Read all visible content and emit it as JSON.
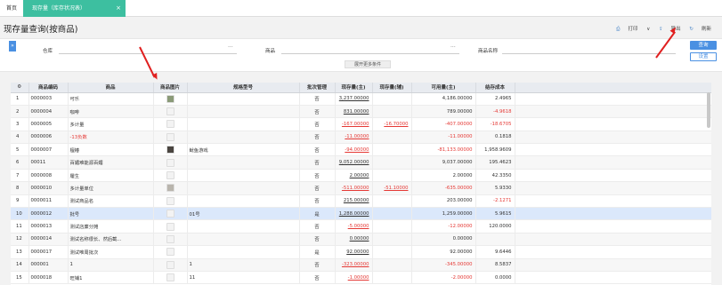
{
  "tabs": {
    "home": "首页",
    "active": "现存量（库存状况表）",
    "close": "×"
  },
  "page": {
    "title": "现存量查询(按商品)"
  },
  "toolbar": {
    "print": "打印",
    "print_caret": "∨",
    "export": "导出",
    "refresh": "刷新"
  },
  "search": {
    "collapse": "»",
    "warehouse_label": "仓库",
    "product_label": "商品",
    "product_name_label": "商品名称",
    "dots": "···",
    "query_button": "查询",
    "settings_button": "设置",
    "expand_more": "展开更多条件"
  },
  "table": {
    "columns": [
      "",
      "商品编码",
      "商品",
      "商品图片",
      "规格型号",
      "批次管理",
      "现存量(主)",
      "现存量(辅)",
      "可用量(主)",
      "结存成本"
    ],
    "rows": [
      {
        "idx": "1",
        "code": "0000003",
        "name": "可乐",
        "thumb": "photo",
        "spec": "",
        "batch": "否",
        "qty_main": "3,237.00000",
        "qty_aux": "",
        "avail": "4,186.00000",
        "cost": "2.4965"
      },
      {
        "idx": "2",
        "code": "0000004",
        "name": "咖啡",
        "thumb": "none",
        "spec": "",
        "batch": "否",
        "qty_main": "831.00000",
        "qty_aux": "",
        "avail": "789.00000",
        "cost": "-4.9618"
      },
      {
        "idx": "3",
        "code": "0000005",
        "name": "多计量",
        "thumb": "none",
        "spec": "",
        "batch": "否",
        "qty_main": "-167.00000",
        "qty_aux": "-16.70000",
        "avail": "-407.00000",
        "cost": "-18.6705"
      },
      {
        "idx": "4",
        "code": "0000006",
        "name": "-13负数",
        "thumb": "none",
        "spec": "",
        "batch": "否",
        "qty_main": "-11.00000",
        "qty_aux": "",
        "avail": "-11.00000",
        "cost": "0.1818"
      },
      {
        "idx": "5",
        "code": "0000007",
        "name": "檀椿",
        "thumb": "dark",
        "spec": "鱿鱼游戏",
        "batch": "否",
        "qty_main": "-94.00000",
        "qty_aux": "",
        "avail": "-81,133.00000",
        "cost": "1,958.9609"
      },
      {
        "idx": "6",
        "code": "00011",
        "name": "百媚难能源百媚",
        "thumb": "none",
        "spec": "",
        "batch": "否",
        "qty_main": "9,052.00000",
        "qty_aux": "",
        "avail": "9,037.00000",
        "cost": "195.4623"
      },
      {
        "idx": "7",
        "code": "0000008",
        "name": "履生",
        "thumb": "none",
        "spec": "",
        "batch": "否",
        "qty_main": "2.00000",
        "qty_aux": "",
        "avail": "2.00000",
        "cost": "42.3350"
      },
      {
        "idx": "8",
        "code": "0000010",
        "name": "多计量单位",
        "thumb": "gray",
        "spec": "",
        "batch": "否",
        "qty_main": "-511.00000",
        "qty_aux": "-51.10000",
        "avail": "-635.00000",
        "cost": "5.9330"
      },
      {
        "idx": "9",
        "code": "0000011",
        "name": "测试商品名",
        "thumb": "none",
        "spec": "",
        "batch": "否",
        "qty_main": "215.00000",
        "qty_aux": "",
        "avail": "203.00000",
        "cost": "-2.1271"
      },
      {
        "idx": "10",
        "code": "0000012",
        "name": "批号",
        "thumb": "none",
        "spec": "01号",
        "batch": "是",
        "qty_main": "1,288.00000",
        "qty_aux": "",
        "avail": "1,259.00000",
        "cost": "5.9615"
      },
      {
        "idx": "11",
        "code": "0000013",
        "name": "测试店廉分摊",
        "thumb": "none",
        "spec": "",
        "batch": "否",
        "qty_main": "-5.00000",
        "qty_aux": "",
        "avail": "-12.00000",
        "cost": "120.0000"
      },
      {
        "idx": "12",
        "code": "0000014",
        "name": "测试名称很长、然后截...",
        "thumb": "none",
        "spec": "",
        "batch": "否",
        "qty_main": "0.00000",
        "qty_aux": "",
        "avail": "0.00000",
        "cost": ""
      },
      {
        "idx": "13",
        "code": "0000017",
        "name": "测试唯周批次",
        "thumb": "none",
        "spec": "",
        "batch": "是",
        "qty_main": "92.00000",
        "qty_aux": "",
        "avail": "92.00000",
        "cost": "9.6446"
      },
      {
        "idx": "14",
        "code": "000001",
        "name": "1",
        "thumb": "none",
        "spec": "1",
        "batch": "否",
        "qty_main": "-323.00000",
        "qty_aux": "",
        "avail": "-345.00000",
        "cost": "8.5837"
      },
      {
        "idx": "15",
        "code": "0000018",
        "name": "旺铺1",
        "thumb": "none",
        "spec": "11",
        "batch": "否",
        "qty_main": "-1.00000",
        "qty_aux": "",
        "avail": "-2.00000",
        "cost": "0.0000"
      }
    ]
  },
  "colors": {
    "tab_active": "#3dbfa0",
    "primary": "#4a90e2",
    "negative": "#e53935",
    "annotation": "#e02020",
    "selected_row": "#dbe8fb"
  }
}
